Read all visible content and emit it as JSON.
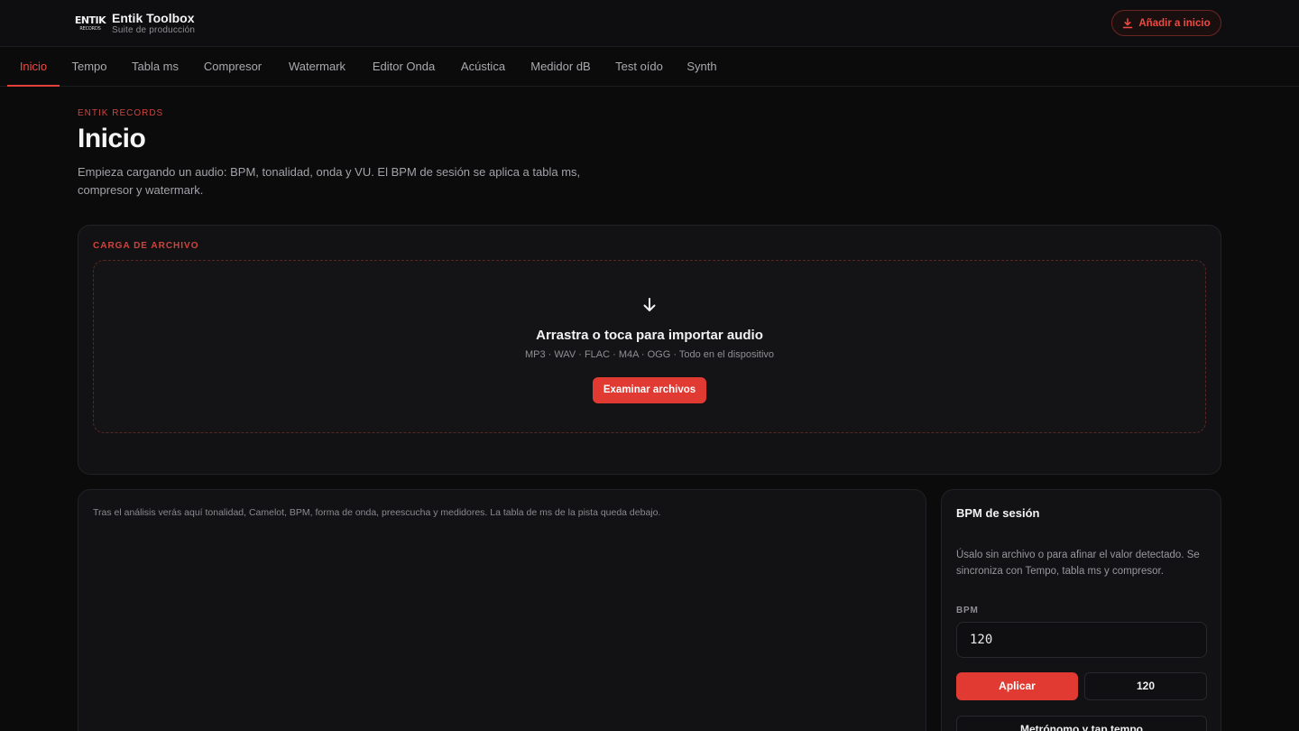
{
  "app": {
    "logo_line1": "ENTIK",
    "logo_line2": "RECORDS",
    "title": "Entik Toolbox",
    "subtitle": "Suite de producción",
    "install_label": "Añadir a inicio"
  },
  "tabs": [
    {
      "label": "Inicio",
      "active": true
    },
    {
      "label": "Tempo"
    },
    {
      "label": "Tabla ms"
    },
    {
      "label": "Compresor"
    },
    {
      "label": "Watermark"
    },
    {
      "label": "Editor Onda"
    },
    {
      "label": "Acústica"
    },
    {
      "label": "Medidor dB"
    },
    {
      "label": "Test oído"
    },
    {
      "label": "Synth"
    }
  ],
  "hero": {
    "eyebrow": "ENTIK RECORDS",
    "title": "Inicio",
    "description": "Empieza cargando un audio: BPM, tonalidad, onda y VU. El BPM de sesión se aplica a tabla ms, compresor y watermark."
  },
  "upload": {
    "label": "CARGA DE ARCHIVO",
    "icon": "arrow-down-icon",
    "title": "Arrastra o toca para importar audio",
    "subtitle": "MP3 · WAV · FLAC · M4A · OGG · Todo en el dispositivo",
    "browse_label": "Examinar archivos"
  },
  "analysis": {
    "placeholder": "Tras el análisis verás aquí tonalidad, Camelot, BPM, forma de onda, preescucha y medidores. La tabla de ms de la pista queda debajo."
  },
  "bpm": {
    "title": "BPM de sesión",
    "description": "Úsalo sin archivo o para afinar el valor detectado. Se sincroniza con Tempo, tabla ms y compresor.",
    "field_label": "BPM",
    "value": "120",
    "apply_label": "Aplicar",
    "current": "120",
    "metronome_label": "Metrónomo y tap tempo"
  },
  "colors": {
    "accent": "#e03a33",
    "background": "#0b0b0c",
    "card": "#121214"
  }
}
